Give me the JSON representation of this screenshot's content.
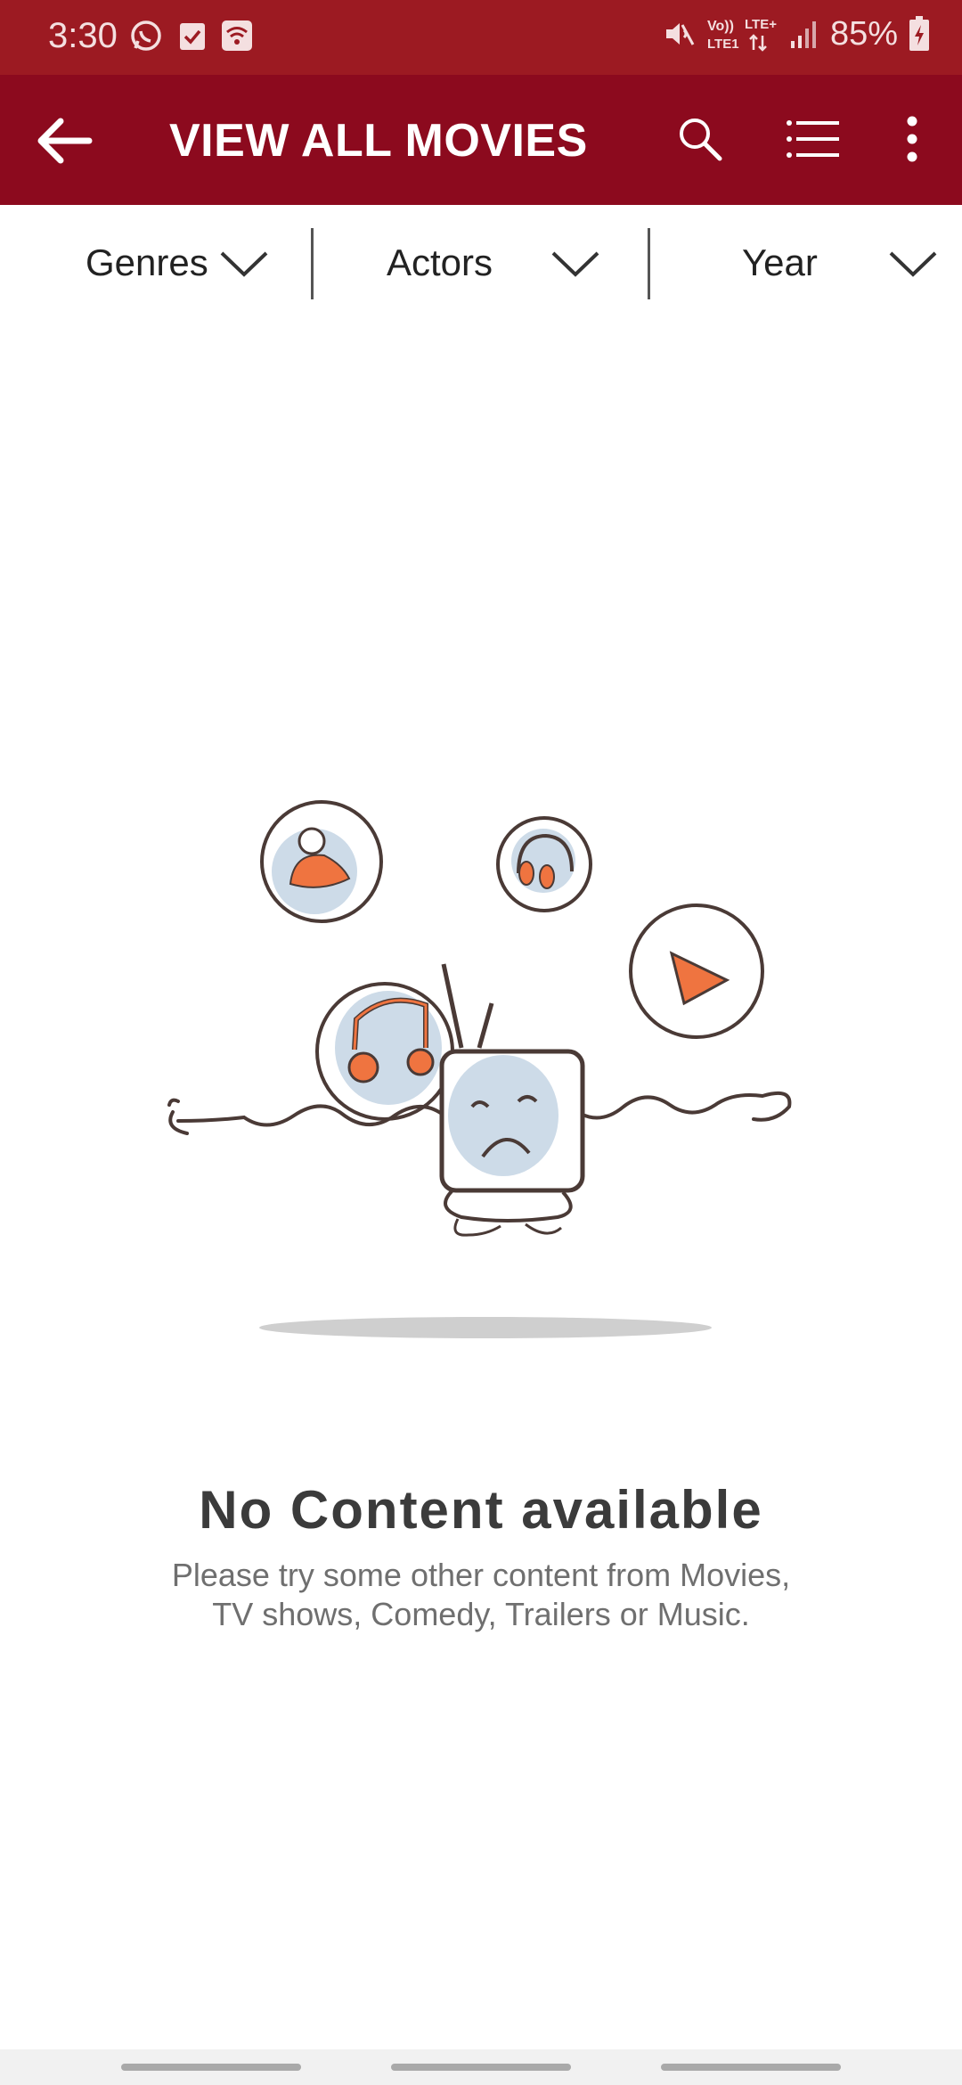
{
  "status_bar": {
    "time": "3:30",
    "battery": "85%",
    "network": "Vo)) LTE+ LTE1",
    "icons": [
      "whatsapp-icon",
      "checkbox-icon",
      "wifi-icon",
      "mute-icon",
      "signal-icon",
      "battery-charging-icon"
    ]
  },
  "app_bar": {
    "title": "VIEW ALL MOVIES",
    "icons": [
      "back-arrow-icon",
      "search-icon",
      "list-icon",
      "more-vert-icon"
    ],
    "background_color": "#8c0a1e"
  },
  "filters": [
    {
      "label": "Genres"
    },
    {
      "label": "Actors"
    },
    {
      "label": "Year"
    }
  ],
  "empty_state": {
    "title": "No Content available",
    "message_line1": "Please try some other content from Movies,",
    "message_line2": "TV shows, Comedy, Trailers or Music."
  }
}
